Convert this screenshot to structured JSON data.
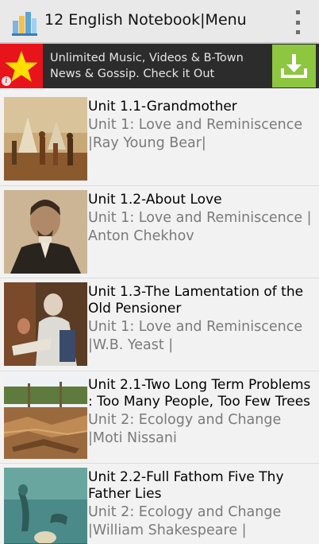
{
  "app": {
    "title": "12 English Notebook|Menu",
    "icon": "app-book-icon",
    "menu_icon": "overflow-menu-icon"
  },
  "ad": {
    "text": "Unlimited Music, Videos & B-Town News & Gossip. Check it Out",
    "logo_icon": "star-flag-icon",
    "info_icon": "info-icon",
    "cta_icon": "download-icon",
    "colors": {
      "flag": "#e8141b",
      "cta": "#8dc63f",
      "banner": "#2c2c2c"
    }
  },
  "lessons": [
    {
      "title": "Unit 1.1-Grandmother",
      "subtitle": "Unit 1: Love and Reminiscence |Ray Young Bear|",
      "image": "native-camp-painting"
    },
    {
      "title": "Unit 1.2-About Love",
      "subtitle": "Unit 1: Love and Reminiscence | Anton Chekhov",
      "image": "chekhov-portrait"
    },
    {
      "title": "Unit 1.3-The Lamentation of the Old Pensioner",
      "subtitle": "Unit 1: Love and Reminiscence |W.B. Yeast |",
      "image": "old-man-painting"
    },
    {
      "title": "Unit 2.1-Two Long Term Problems : Too Many People, Too Few Trees",
      "subtitle": "Unit 2: Ecology and Change |Moti Nissani",
      "image": "deforestation-photo"
    },
    {
      "title": "Unit 2.2-Full Fathom Five Thy Father Lies",
      "subtitle": "Unit 2: Ecology and Change |William Shakespeare |",
      "image": "undersea-painting"
    }
  ]
}
